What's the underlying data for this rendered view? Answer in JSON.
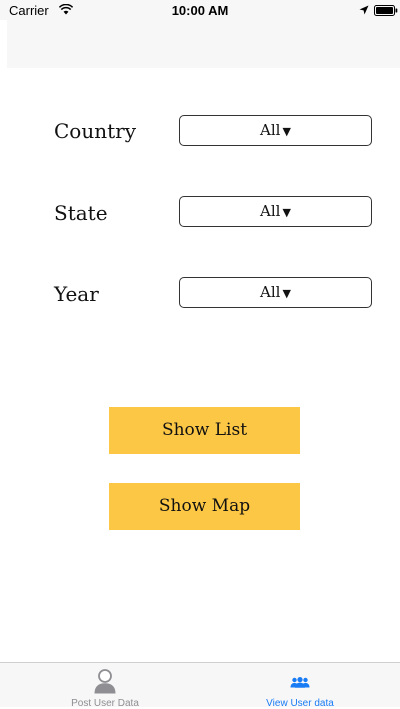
{
  "status_bar": {
    "carrier": "Carrier",
    "time": "10:00 AM"
  },
  "filters": [
    {
      "label": "Country",
      "value": "All"
    },
    {
      "label": "State",
      "value": "All"
    },
    {
      "label": "Year",
      "value": "All"
    }
  ],
  "picker_arrow": "▼",
  "actions": {
    "show_list": "Show List",
    "show_map": "Show Map"
  },
  "tab_bar": {
    "items": [
      {
        "label": "Post User Data",
        "icon": "person-icon",
        "selected": false
      },
      {
        "label": "View User data",
        "icon": "people-icon",
        "selected": true
      }
    ]
  },
  "colors": {
    "button_bg": "#fcc745",
    "tab_active": "#1a7cf5",
    "tab_inactive": "#8e8e93",
    "bar_bg": "#f7f7f7"
  }
}
